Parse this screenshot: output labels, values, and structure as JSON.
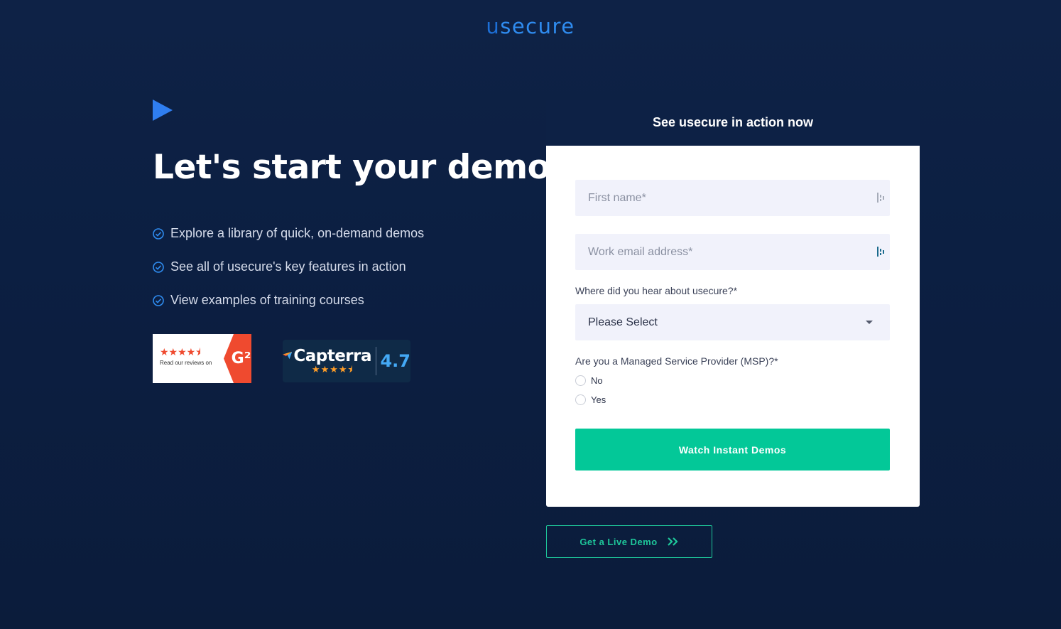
{
  "brand": {
    "logo_text_u": "u",
    "logo_text_rest": "secure",
    "accent_color": "#2f8cf0",
    "cta_color": "#03c898",
    "live_demo_color": "#1ec79a"
  },
  "hero": {
    "play_icon": "play-icon",
    "title": "Let's start your demo",
    "bullets": [
      "Explore a library of quick, on-demand demos",
      "See all of usecure's key features in action",
      "View examples of training courses"
    ]
  },
  "badges": {
    "g2": {
      "stars": "★★★★⯨",
      "text": "Read our reviews on",
      "logo": "G²"
    },
    "capterra": {
      "name": "Capterra",
      "stars": "★★★★⯨",
      "rating": "4.7"
    }
  },
  "form": {
    "header": "See usecure in action now",
    "first_name_placeholder": "First name*",
    "email_placeholder": "Work email address*",
    "source_label": "Where did you hear about usecure?*",
    "source_select_value": "Please Select",
    "msp_label": "Are you a Managed Service Provider (MSP)?*",
    "msp_options": [
      "No",
      "Yes"
    ],
    "submit_label": "Watch Instant Demos"
  },
  "live_demo": {
    "label": "Get a Live Demo"
  }
}
